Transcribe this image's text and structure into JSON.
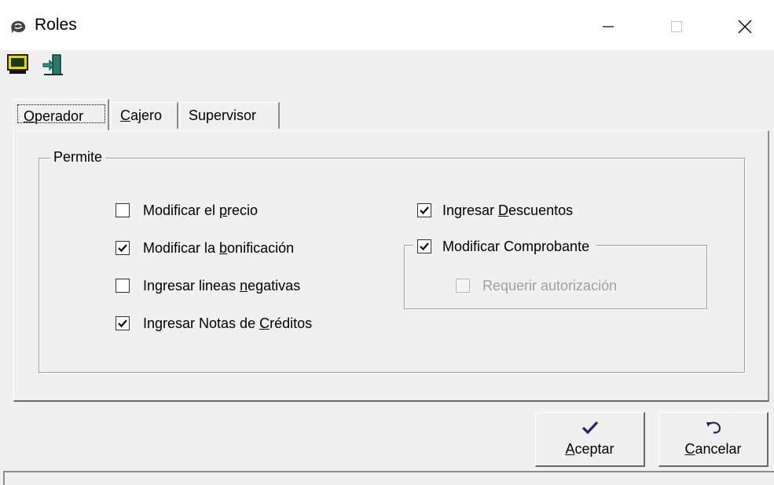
{
  "window": {
    "title": "Roles",
    "icons": {
      "app": "app-icon",
      "minimize": "minimize-icon",
      "maximize": "maximize-icon",
      "close": "close-icon"
    }
  },
  "toolbar": {
    "icons": [
      "monitor-icon",
      "exit-door-icon"
    ]
  },
  "tabs": [
    {
      "key": "O",
      "rest": "perador",
      "active": true
    },
    {
      "key": "C",
      "rest": "ajero",
      "active": false
    },
    {
      "pre": "Supervisor",
      "active": false
    }
  ],
  "group": {
    "legend": "Permite",
    "left_column": [
      {
        "pre": "Modificar el ",
        "key": "p",
        "post": "recio",
        "checked": false
      },
      {
        "pre": "Modificar la ",
        "key": "b",
        "post": "onificación",
        "checked": true
      },
      {
        "pre": "Ingresar lineas ",
        "key": "n",
        "post": "egativas",
        "checked": false
      },
      {
        "pre": "Ingresar Notas de ",
        "key": "C",
        "post": "réditos",
        "checked": true
      }
    ],
    "right_column": {
      "descuentos": {
        "pre": "Ingresar ",
        "key": "D",
        "post": "escuentos",
        "checked": true
      },
      "comprobante": {
        "label": "Modificar Comprobante",
        "checked": true
      },
      "autorizacion": {
        "label": "Requerir autorización",
        "checked": false,
        "enabled": false
      }
    }
  },
  "buttons": {
    "accept": {
      "key": "A",
      "rest": "ceptar",
      "icon": "checkmark-icon"
    },
    "cancel": {
      "key": "C",
      "rest": "ancelar",
      "icon": "undo-arrow-icon"
    }
  }
}
